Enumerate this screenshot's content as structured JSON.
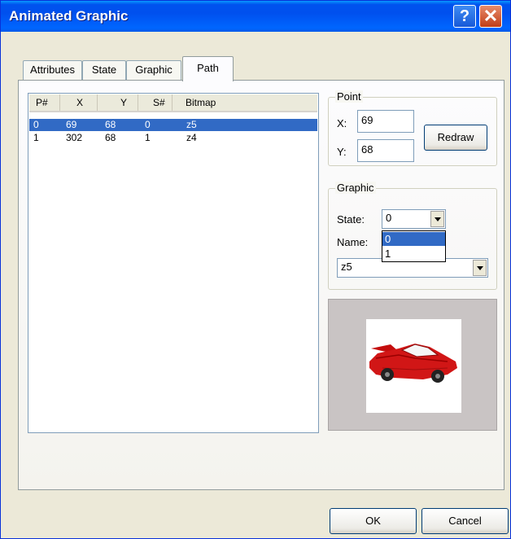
{
  "window": {
    "title": "Animated Graphic",
    "help_glyph": "?",
    "close_glyph": "✕"
  },
  "tabs": [
    {
      "label": "Attributes"
    },
    {
      "label": "State"
    },
    {
      "label": "Graphic"
    },
    {
      "label": "Path"
    }
  ],
  "path_list": {
    "columns": [
      "P#",
      "X",
      "Y",
      "S#",
      "Bitmap"
    ],
    "rows": [
      {
        "p": "0",
        "x": "69",
        "y": "68",
        "s": "0",
        "bitmap": "z5"
      },
      {
        "p": "1",
        "x": "302",
        "y": "68",
        "s": "1",
        "bitmap": "z4"
      }
    ]
  },
  "point": {
    "label": "Point",
    "x_label": "X:",
    "x_value": "69",
    "y_label": "Y:",
    "y_value": "68",
    "redraw_label": "Redraw"
  },
  "graphic": {
    "label": "Graphic",
    "state_label": "State:",
    "state_value": "0",
    "state_options": [
      "0",
      "1"
    ],
    "name_label": "Name:",
    "name_value": "z5"
  },
  "preview": {
    "icon": "red-car-image"
  },
  "footer": {
    "ok_label": "OK",
    "cancel_label": "Cancel"
  },
  "colors": {
    "selection": "#316ac5",
    "title_bar": "#0054e3"
  }
}
